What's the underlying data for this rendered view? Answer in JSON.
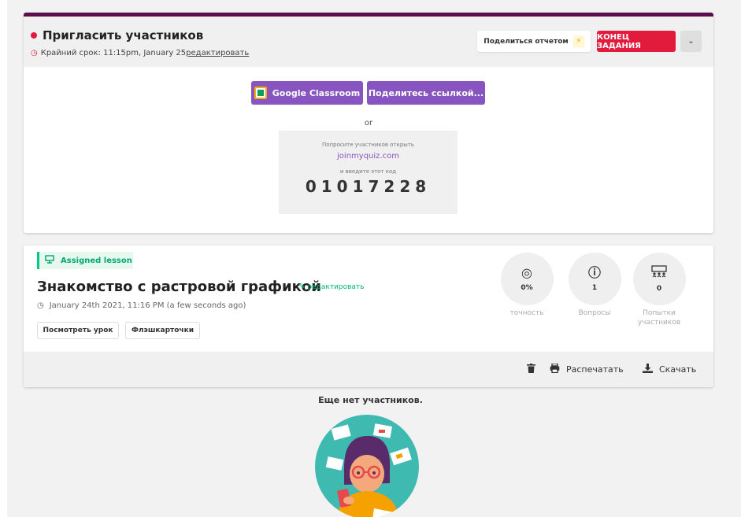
{
  "invite": {
    "title": "Пригласить участников",
    "deadline": "Крайний срок: 11:15pm, January 25",
    "deadline_edit": " редактировать",
    "share_report": "Поделиться отчетом",
    "end_task": "КОНЕЦ ЗАДАНИЯ",
    "google_classroom": "Google Classroom",
    "share_link": "Поделитесь ссылкой...",
    "or": "or",
    "ask_open": "Попросите участников открыть",
    "join_url": "joinmyquiz.com",
    "enter_code": "и введите этот код",
    "code": "01017228"
  },
  "lesson": {
    "tag": "Assigned lesson",
    "title": "Знакомство с растровой графикой",
    "edit": "редактировать",
    "date": "January 24th 2021, 11:16 PM (a few seconds ago)",
    "view_button": "Посмотреть урок",
    "flash_button": "Флэшкарточки",
    "stats": [
      {
        "label": "точность",
        "value": "0%"
      },
      {
        "label": "Вопросы",
        "value": "1"
      },
      {
        "label_line1": "Попытки",
        "label_line2": "участников",
        "value": "0"
      }
    ],
    "print": "Распечатать",
    "download": "Скачать"
  },
  "no_participants": "Еще нет участников.",
  "colors": {
    "accent": "#8854c0",
    "danger": "#e21b3c",
    "green": "#00c985",
    "header_border": "#5a0e4e"
  }
}
